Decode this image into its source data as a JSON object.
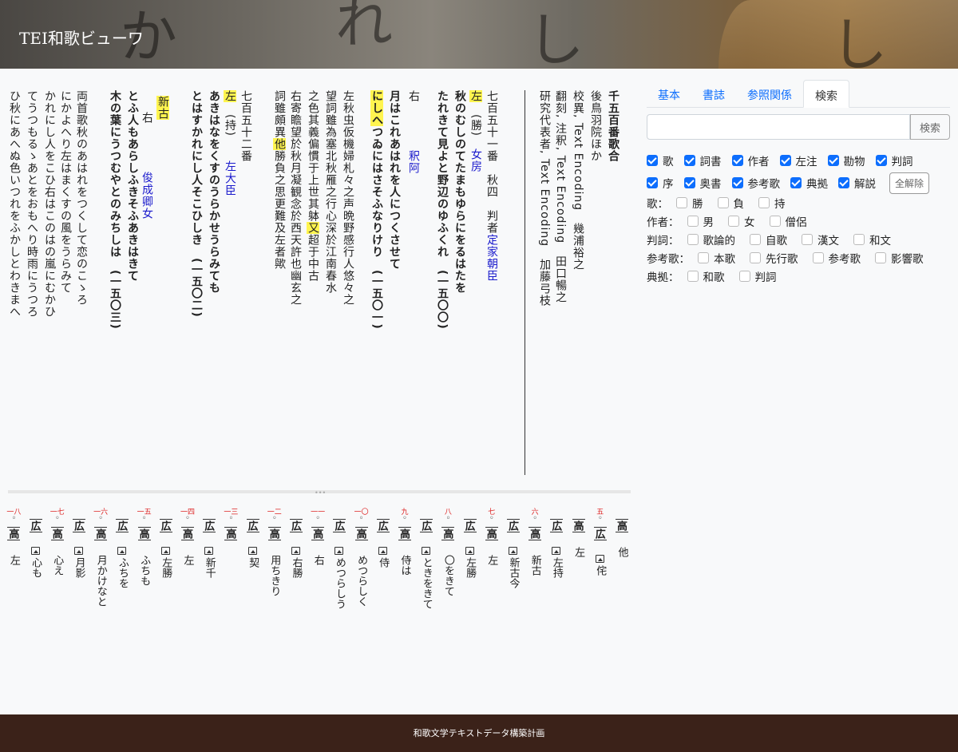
{
  "header": {
    "title": "TEI和歌ビューワ"
  },
  "main": {
    "columns": [
      {
        "text": "千五百番歌合",
        "bold": true
      },
      {
        "text": "後鳥羽院ほか"
      },
      {
        "text": "校異, Text Encoding　幾浦裕之"
      },
      {
        "text": "翻刻, 注釈, Text Encoding　田口暢之"
      },
      {
        "text": "研究代表者, Text Encoding　加藤弓枝"
      },
      {
        "text": "七百五十一番　秋四　判者",
        "blue": "定家朝臣"
      },
      {
        "text": "左　(勝)　女房",
        "hl": "左"
      },
      {
        "text": "秋のむしのてたまもゆらにをるはたを",
        "bold": true
      },
      {
        "text": "たれきて見よと野辺のゆふくれ　(一五〇〇)",
        "bold": true
      },
      {
        "text": "右　　　　釈阿"
      },
      {
        "text": "月はこれあはれを人につくさせて",
        "bold": true
      },
      {
        "text": "にしへつゐにはさそふなりけり　(一五〇一)",
        "bold": true,
        "hl": "にしへ"
      },
      {
        "text": "左秋虫仮機婦札々之声晩野感行人悠々之"
      },
      {
        "text": "望詞雖為塞北秋雁之行心深於江南春水"
      },
      {
        "text": "之色其義偏慣于上世其躰又超于中古",
        "hl": "又"
      },
      {
        "text": "右寄瞻望於秋月凝観念於西天許也幽玄之"
      },
      {
        "text": "詞雖頗異他勝負之思更難及左者歟",
        "hl": "他"
      },
      {
        "text": "七百五十二番"
      },
      {
        "text": "左　(持)　　左大臣",
        "hl": "左"
      },
      {
        "text": "あきはなをくすのうらかせうらみても",
        "bold": true
      },
      {
        "text": "とはすかれにし人そこひしき　(一五〇二)",
        "bold": true
      },
      {
        "text": "新古",
        "hl": "新古"
      },
      {
        "text": "右　　　　俊成卿女"
      },
      {
        "text": "とふ人もあらしふきそふあきはきて",
        "bold": true
      },
      {
        "text": "木の葉にうつむやとのみちしは　(一五〇三)",
        "bold": true
      },
      {
        "text": "両首歌秋のあはれをつくして恋のこゝろ"
      },
      {
        "text": "にかよへり左はまくすの風をうらみて"
      },
      {
        "text": "かれにし人をこひ右はこのはの嵐にむかひ"
      },
      {
        "text": "てうつもるゝあとをおもへり時雨にうつろ"
      },
      {
        "text": "ひ秋にあへぬ色いつれをふかしとわきまへ"
      }
    ],
    "blue_names": [
      "定家朝臣",
      "女房",
      "釈阿",
      "左大臣",
      "俊成卿女"
    ]
  },
  "variants": [
    {
      "num": "",
      "src": "高",
      "text": "他"
    },
    {
      "num": "五",
      "src": "広",
      "text": "侘"
    },
    {
      "num": "",
      "src": "高",
      "text": "左"
    },
    {
      "num": "",
      "src": "広",
      "text": "左持"
    },
    {
      "num": "六",
      "src": "高",
      "text": "新古"
    },
    {
      "num": "",
      "src": "広",
      "text": "新古今"
    },
    {
      "num": "七",
      "src": "高",
      "text": "左"
    },
    {
      "num": "",
      "src": "広",
      "text": "左勝"
    },
    {
      "num": "八",
      "src": "高",
      "text": "〇をきて"
    },
    {
      "num": "",
      "src": "広",
      "text": "ときをきて"
    },
    {
      "num": "九",
      "src": "高",
      "text": "侍は"
    },
    {
      "num": "",
      "src": "広",
      "text": "侍"
    },
    {
      "num": "一〇",
      "src": "高",
      "text": "めつらしく"
    },
    {
      "num": "",
      "src": "広",
      "text": "めつらしう"
    },
    {
      "num": "一一",
      "src": "高",
      "text": "右"
    },
    {
      "num": "",
      "src": "広",
      "text": "右勝"
    },
    {
      "num": "一二",
      "src": "高",
      "text": "用ちきり"
    },
    {
      "num": "",
      "src": "広",
      "text": "契"
    },
    {
      "num": "一三",
      "src": "高",
      "text": ""
    },
    {
      "num": "",
      "src": "広",
      "text": "新千"
    },
    {
      "num": "一四",
      "src": "高",
      "text": "左"
    },
    {
      "num": "",
      "src": "広",
      "text": "左勝"
    },
    {
      "num": "一五",
      "src": "高",
      "text": "ふちも"
    },
    {
      "num": "",
      "src": "広",
      "text": "ふちを"
    },
    {
      "num": "一六",
      "src": "高",
      "text": "月かけなと"
    },
    {
      "num": "",
      "src": "広",
      "text": "月影"
    },
    {
      "num": "一七",
      "src": "高",
      "text": "心え"
    },
    {
      "num": "",
      "src": "広",
      "text": "心も"
    },
    {
      "num": "一八",
      "src": "高",
      "text": "左"
    }
  ],
  "right": {
    "tabs": [
      "基本",
      "書誌",
      "参照関係",
      "検索"
    ],
    "active_tab": "検索",
    "search": {
      "value": "",
      "placeholder": "",
      "button": "検索"
    },
    "checks_row1": [
      {
        "label": "歌",
        "checked": true
      },
      {
        "label": "詞書",
        "checked": true
      },
      {
        "label": "作者",
        "checked": true
      },
      {
        "label": "左注",
        "checked": true
      },
      {
        "label": "勘物",
        "checked": true
      },
      {
        "label": "判詞",
        "checked": true
      }
    ],
    "checks_row2": [
      {
        "label": "序",
        "checked": true
      },
      {
        "label": "奥書",
        "checked": true
      },
      {
        "label": "参考歌",
        "checked": true
      },
      {
        "label": "典拠",
        "checked": true
      },
      {
        "label": "解説",
        "checked": true
      }
    ],
    "clear_label": "全解除",
    "filters": [
      {
        "label": "歌：",
        "options": [
          "勝",
          "負",
          "持"
        ]
      },
      {
        "label": "作者：",
        "options": [
          "男",
          "女",
          "僧侶"
        ]
      },
      {
        "label": "判詞：",
        "options": [
          "歌論的",
          "自歌",
          "漢文",
          "和文"
        ]
      },
      {
        "label": "参考歌：",
        "options": [
          "本歌",
          "先行歌",
          "参考歌",
          "影響歌"
        ]
      },
      {
        "label": "典拠：",
        "options": [
          "和歌",
          "判詞"
        ]
      }
    ]
  },
  "footer": {
    "text": "和歌文学テキストデータ構築計画"
  }
}
